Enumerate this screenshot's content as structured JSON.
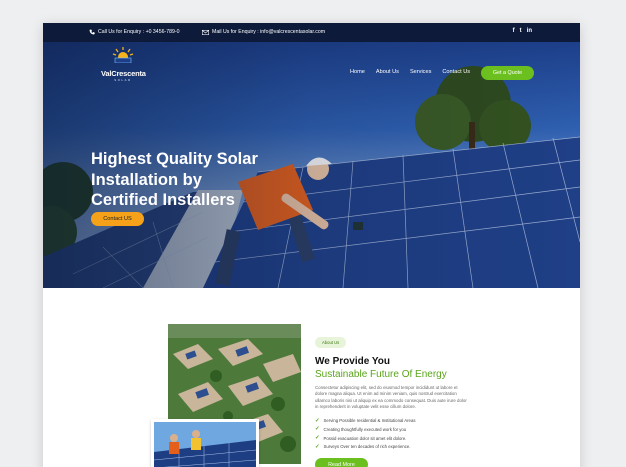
{
  "topbar": {
    "phone": "Call Us for Enquiry : +0 3456-789-0",
    "mail": "Mail Us for Enquiry : info@valcrescentasolar.com",
    "social": [
      "f",
      "t",
      "in"
    ]
  },
  "brand": {
    "name": "ValCrescenta",
    "tagline": "SOLAR"
  },
  "nav": {
    "items": [
      "Home",
      "About Us",
      "Services",
      "Contact Us"
    ],
    "quote": "Get a Quote"
  },
  "hero": {
    "lines": [
      "Highest Quality Solar",
      "Installation by",
      "Certified Installers"
    ],
    "cta": "Contact US"
  },
  "about": {
    "pill": "About Us",
    "title": "We Provide You",
    "subtitle": "Sustainable Future Of Energy",
    "body": "Consectetur adipiscing elit, sed do eiusmod tempor incididunt ut labore et dolore magna aliqua. Ut enim ad minim veniam, quis nostrud exercitation ullamco laboris nisi ut aliquip ex ea commodo consequat. Duis aute irure dolor in reprehenderit in voluptate velit esse cillum dolore.",
    "bullets": [
      "Serving Possible residential & Institutional Areas",
      "Creating thoughtfully executed work for you",
      "Possid evacuation dolor sit amet elit dolore.",
      "Surveys Over ten decades of rich experience."
    ],
    "button": "Read More"
  },
  "colors": {
    "accent_green": "#6bbf1f",
    "cta_orange": "#f5a21a",
    "topbar_navy": "#0d1a3a"
  }
}
